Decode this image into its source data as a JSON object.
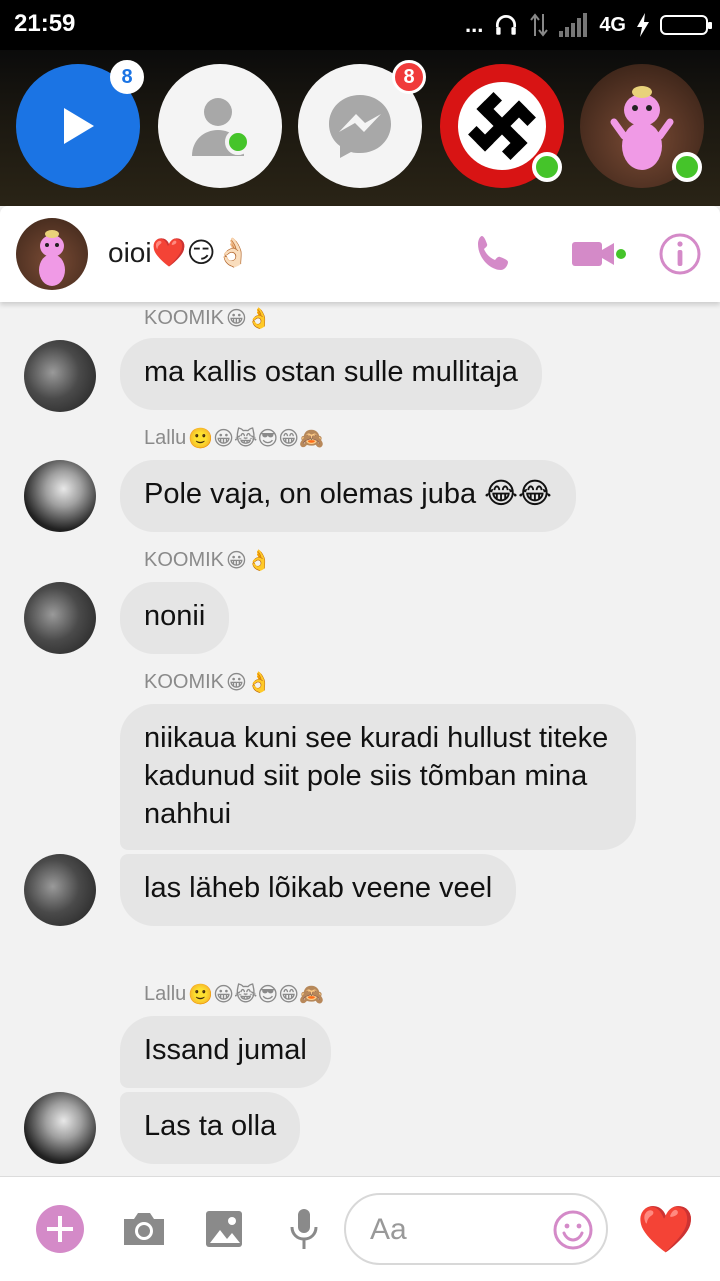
{
  "status_bar": {
    "time": "21:59",
    "dots": "...",
    "network": "4G"
  },
  "chat_heads": [
    {
      "name": "video-chat-head",
      "badge": "8"
    },
    {
      "name": "people-chat-head"
    },
    {
      "name": "messenger-chat-head",
      "badge": "8"
    },
    {
      "name": "symbol-avatar-chat-head"
    },
    {
      "name": "pink-character-avatar-chat-head"
    }
  ],
  "header": {
    "name": "oioi",
    "emoji": "❤️😏👌🏻"
  },
  "messages": [
    {
      "sender": "KOOMIK",
      "sender_emoji": "😀👌",
      "text": "ma kallis ostan sulle mullitaja"
    },
    {
      "sender": "Lallu",
      "sender_emoji": "🙂😀😹😎😁🙈",
      "text": "Pole vaja, on olemas juba 😂😂"
    },
    {
      "sender": "KOOMIK",
      "sender_emoji": "😀👌",
      "text": "nonii"
    },
    {
      "sender": "KOOMIK",
      "sender_emoji": "😀👌",
      "text": "niikaua kuni see kuradi hullust titeke kadunud siit pole siis tõmban mina nahhui"
    },
    {
      "text": "las läheb lõikab veene veel"
    },
    {
      "sender": "Lallu",
      "sender_emoji": "🙂😀😹😎😁🙈",
      "text": "Issand jumal"
    },
    {
      "text": "Las ta olla"
    }
  ],
  "composer": {
    "placeholder": "Aa",
    "like_emoji": "❤️"
  },
  "colors": {
    "accent": "#d48ac8",
    "messenger_blue": "#1b74e4",
    "online_green": "#45c42a"
  }
}
